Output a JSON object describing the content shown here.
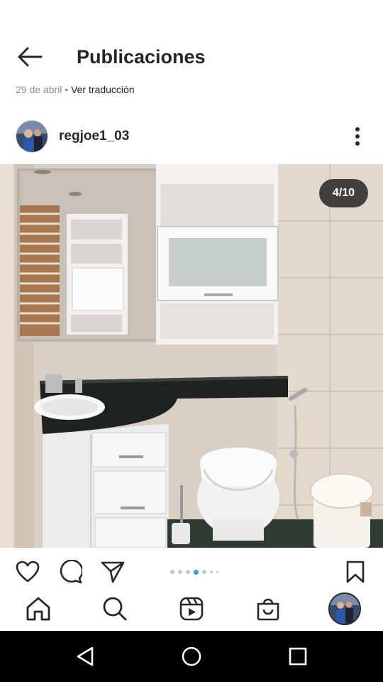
{
  "header": {
    "title": "Publicaciones",
    "back_icon": "arrow-left-icon"
  },
  "previous_post": {
    "date": "29 de abril",
    "separator": "•",
    "translate": "Ver traducción"
  },
  "post": {
    "username": "regjoe1_03",
    "more_icon": "more-vertical-icon",
    "image_counter": "4/10",
    "image_subject": "bathroom",
    "carousel": {
      "total_dots": 7,
      "active_index": 3
    }
  },
  "actions": {
    "like_icon": "heart-icon",
    "comment_icon": "comment-icon",
    "share_icon": "send-icon",
    "save_icon": "bookmark-icon"
  },
  "bottom_nav": {
    "items": [
      "home-icon",
      "search-icon",
      "reels-icon",
      "shop-icon",
      "profile-avatar"
    ]
  },
  "system_nav": {
    "items": [
      "back-triangle-icon",
      "home-circle-icon",
      "recents-square-icon"
    ]
  },
  "colors": {
    "accent_blue": "#3897f0",
    "text_primary": "#262626",
    "text_secondary": "#8e8e8e",
    "system_bar": "#000000"
  }
}
